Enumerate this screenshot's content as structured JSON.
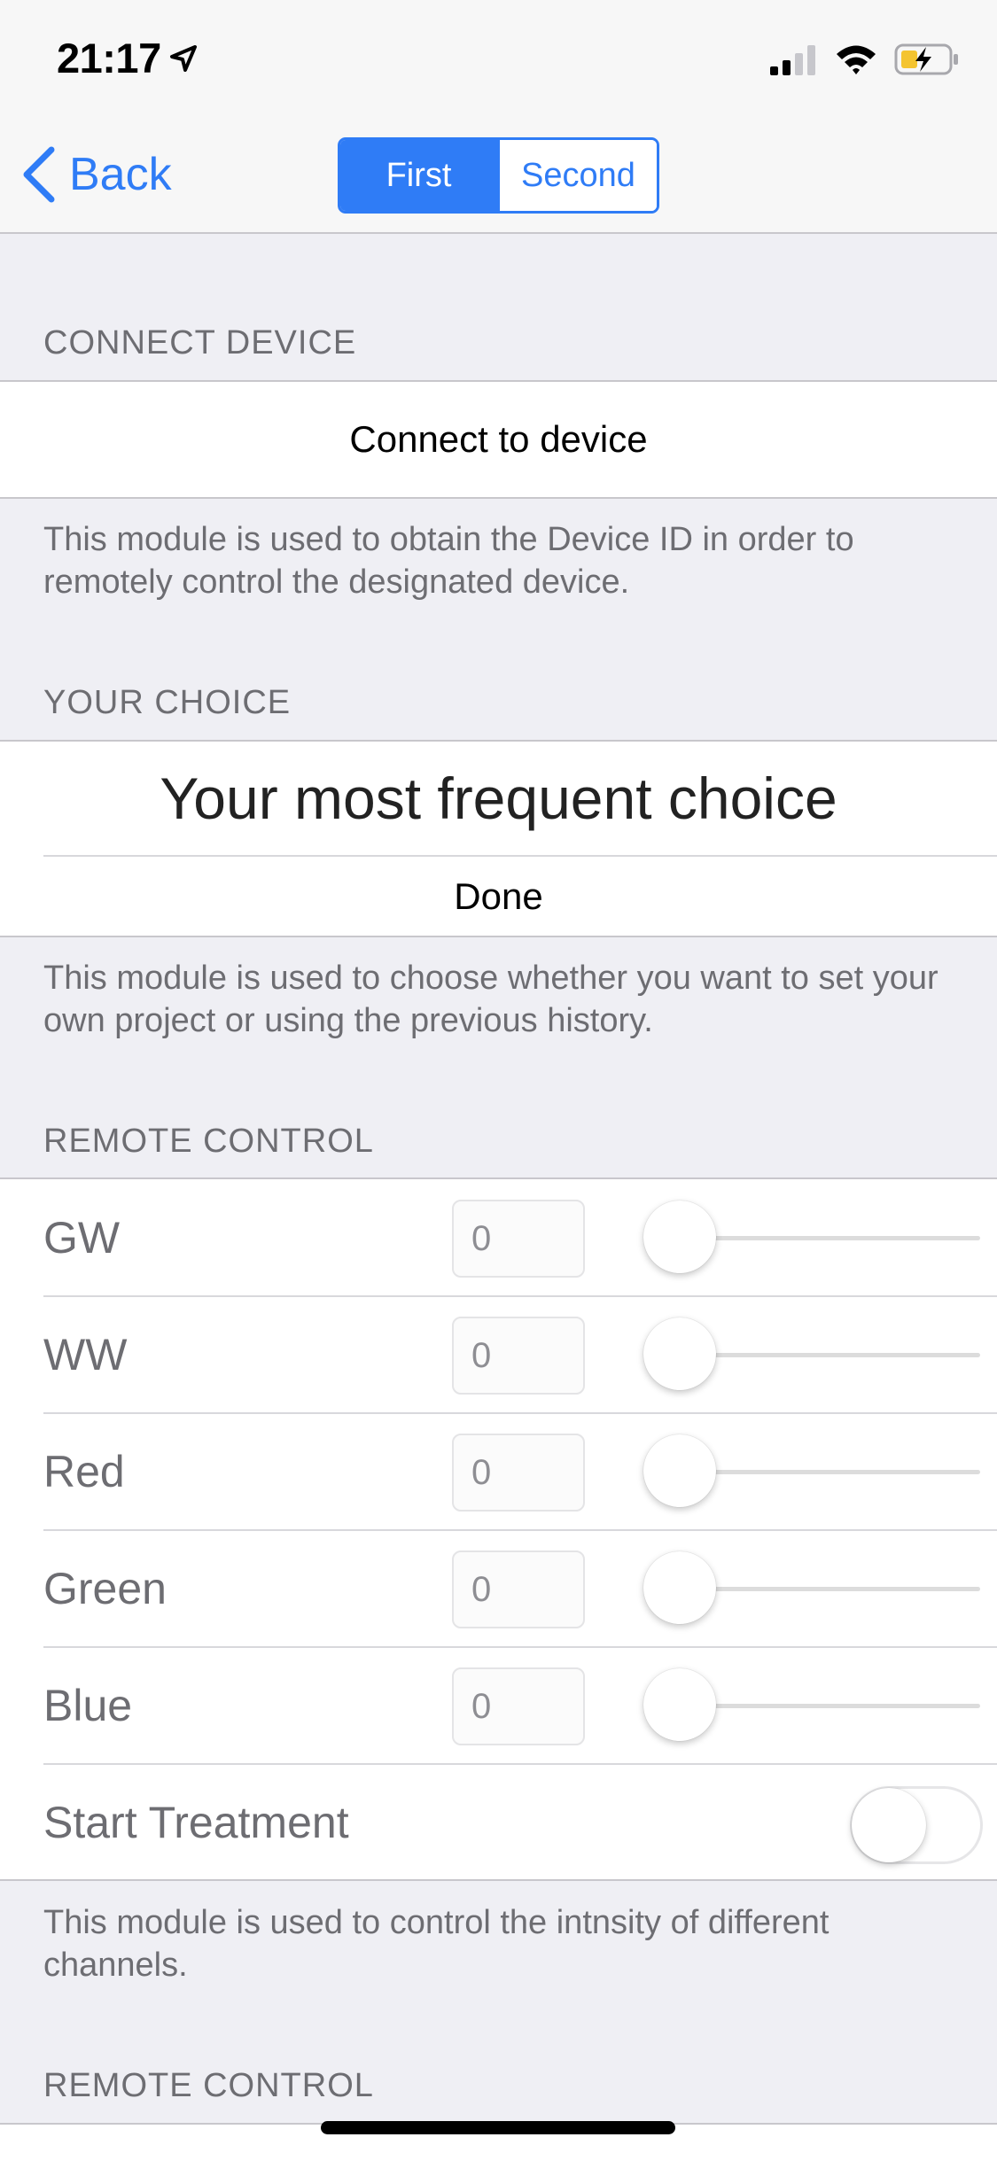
{
  "status": {
    "time": "21:17",
    "colors": {
      "battery_fill": "#f4c430",
      "signal": "#000000"
    }
  },
  "nav": {
    "back_label": "Back",
    "segments": [
      {
        "label": "First",
        "selected": true
      },
      {
        "label": "Second",
        "selected": false
      }
    ],
    "accent_color": "#2f7cf6"
  },
  "sections": {
    "connect": {
      "header": "CONNECT DEVICE",
      "button_label": "Connect to device",
      "footer": "This module is used to obtain the Device ID in order to remotely control the designated device."
    },
    "choice": {
      "header": "YOUR CHOICE",
      "title": "Your most frequent choice",
      "done_label": "Done",
      "footer": "This module is used to choose whether you want to set your own project or using the previous history."
    },
    "remote": {
      "header": "REMOTE CONTROL",
      "channels": [
        {
          "label": "GW",
          "value": "0",
          "slider_fraction": 0
        },
        {
          "label": "WW",
          "value": "0",
          "slider_fraction": 0
        },
        {
          "label": "Red",
          "value": "0",
          "slider_fraction": 0
        },
        {
          "label": "Green",
          "value": "0",
          "slider_fraction": 0
        },
        {
          "label": "Blue",
          "value": "0",
          "slider_fraction": 0
        }
      ],
      "treatment_label": "Start Treatment",
      "treatment_on": false,
      "footer": "This module is used to control the intnsity of different channels."
    },
    "remote2": {
      "header": "REMOTE CONTROL"
    }
  }
}
